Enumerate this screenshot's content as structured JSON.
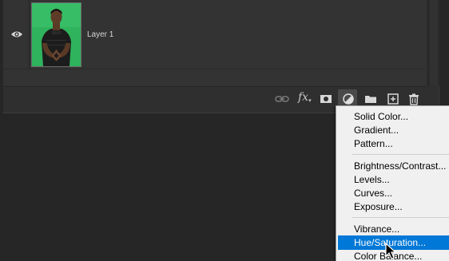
{
  "layers": [
    {
      "name": "Layer 1",
      "visible": true
    }
  ],
  "toolbar": {
    "icons": [
      "link-icon",
      "fx-icon",
      "layer-mask-icon",
      "adjustment-layer-icon",
      "group-folder-icon",
      "new-layer-icon",
      "delete-trash-icon"
    ],
    "fx_label": "fx"
  },
  "menu": {
    "groups": [
      [
        "Solid Color...",
        "Gradient...",
        "Pattern..."
      ],
      [
        "Brightness/Contrast...",
        "Levels...",
        "Curves...",
        "Exposure..."
      ],
      [
        "Vibrance...",
        "Hue/Saturation...",
        "Color Balance..."
      ]
    ],
    "highlighted": "Hue/Saturation..."
  },
  "colors": {
    "panel_bg": "#333333",
    "menu_bg": "#f0f0f0",
    "highlight": "#0078d7",
    "thumb_green": "#2cae58"
  }
}
